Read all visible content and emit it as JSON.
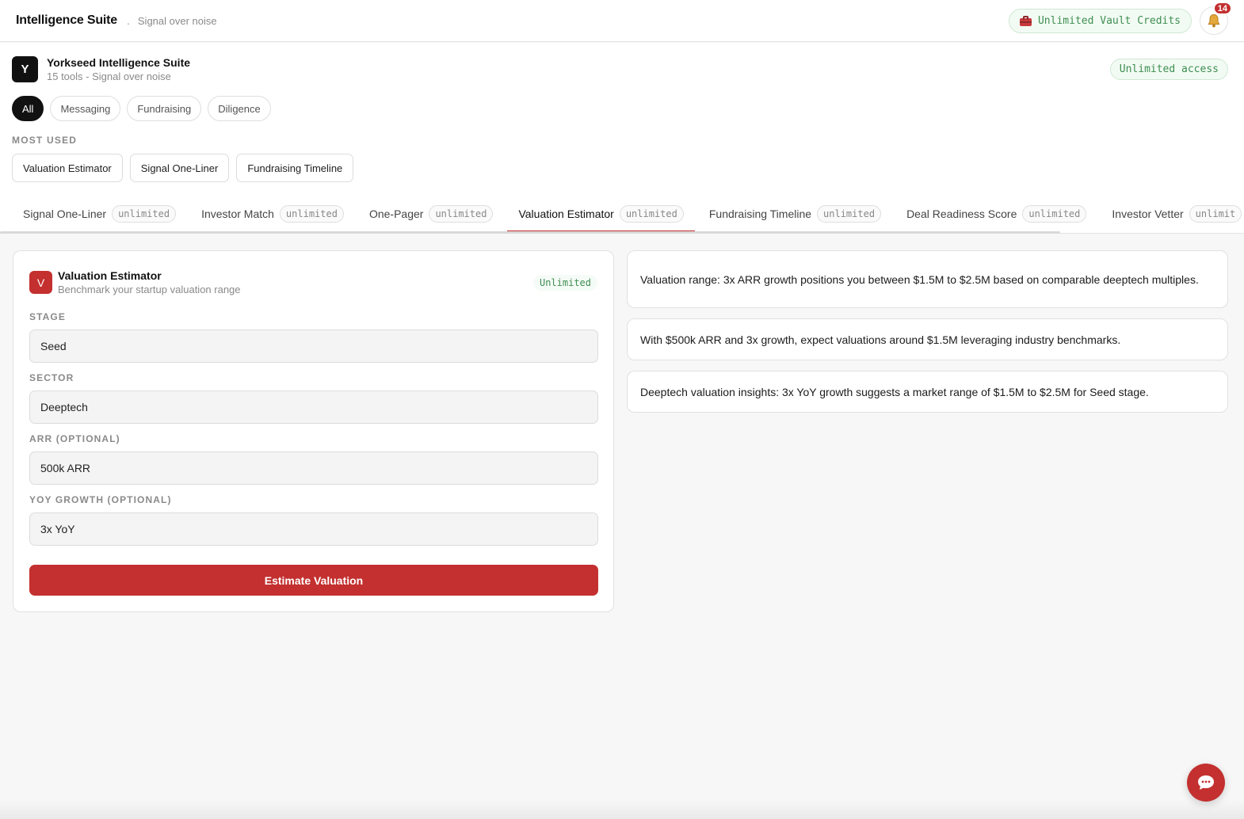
{
  "topbar": {
    "brand": "Intelligence Suite",
    "separator": ".",
    "tagline": "Signal over noise",
    "vault_label": "Unlimited Vault Credits",
    "vault_icon": "briefcase-icon",
    "bell_icon": "bell-icon",
    "notification_count": "14"
  },
  "suite": {
    "avatar": "Y",
    "name": "Yorkseed Intelligence Suite",
    "subtitle": "15 tools - Signal over noise",
    "access_label": "Unlimited access"
  },
  "filters": [
    "All",
    "Messaging",
    "Fundraising",
    "Diligence"
  ],
  "active_filter": "All",
  "most_used": {
    "label": "MOST USED",
    "items": [
      "Valuation Estimator",
      "Signal One-Liner",
      "Fundraising Timeline"
    ]
  },
  "tabs": [
    {
      "label": "Signal One-Liner",
      "badge": "unlimited"
    },
    {
      "label": "Investor Match",
      "badge": "unlimited"
    },
    {
      "label": "One-Pager",
      "badge": "unlimited"
    },
    {
      "label": "Valuation Estimator",
      "badge": "unlimited"
    },
    {
      "label": "Fundraising Timeline",
      "badge": "unlimited"
    },
    {
      "label": "Deal Readiness Score",
      "badge": "unlimited"
    },
    {
      "label": "Investor Vetter",
      "badge": "unlimit"
    }
  ],
  "active_tab": "Valuation Estimator",
  "tool": {
    "icon": "V",
    "title": "Valuation Estimator",
    "subtitle": "Benchmark your startup valuation range",
    "tag": "Unlimited",
    "fields": {
      "stage": {
        "label": "STAGE",
        "value": "Seed"
      },
      "sector": {
        "label": "SECTOR",
        "value": "Deeptech"
      },
      "arr": {
        "label": "ARR (OPTIONAL)",
        "value": "500k ARR"
      },
      "growth": {
        "label": "YOY GROWTH (OPTIONAL)",
        "value": "3x YoY"
      }
    },
    "submit_label": "Estimate Valuation"
  },
  "results": [
    "Valuation range: 3x ARR growth positions you between $1.5M to $2.5M based on comparable deeptech multiples.",
    "With $500k ARR and 3x growth, expect valuations around $1.5M leveraging industry benchmarks.",
    "Deeptech valuation insights: 3x YoY growth suggests a market range of $1.5M to $2.5M for Seed stage."
  ],
  "chat_icon": "chat-bubble-icon",
  "colors": {
    "accent": "#c3302f",
    "success": "#3e8e52",
    "dark": "#111111"
  }
}
